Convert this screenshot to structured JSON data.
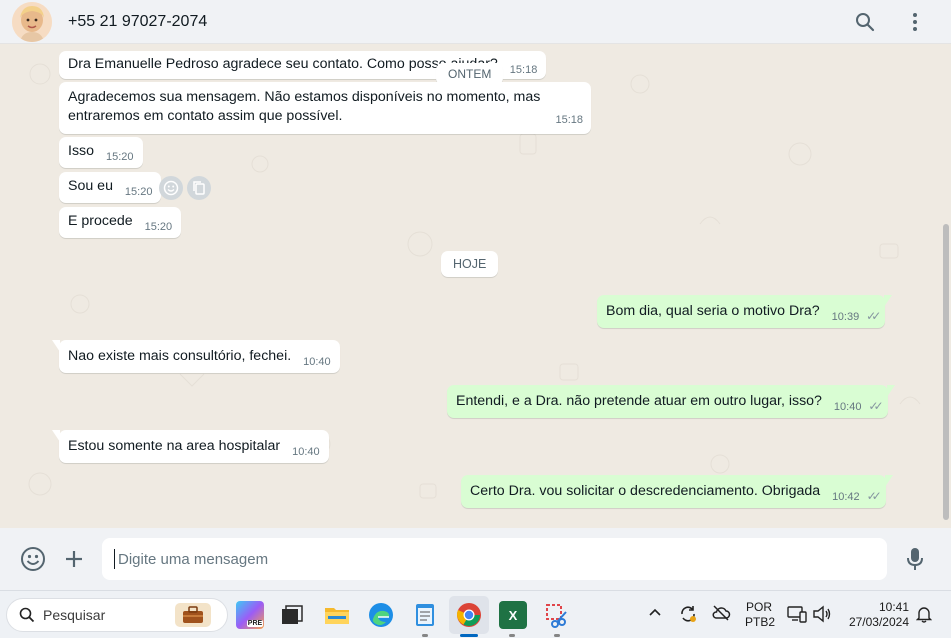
{
  "header": {
    "contact_name": "+55 21 97027-2074",
    "icons": [
      "avatar",
      "search-icon",
      "menu-icon"
    ]
  },
  "chat": {
    "date_chips": {
      "yesterday": "ONTEM",
      "today": "HOJE"
    },
    "messages": [
      {
        "dir": "in",
        "text": "Dra Emanuelle Pedroso agradece seu contato. Como posso ajudar?",
        "time": "15:18"
      },
      {
        "dir": "in",
        "text": "Agradecemos sua mensagem. Não estamos disponíveis no momento, mas entraremos em contato assim que possível.",
        "time": "15:18"
      },
      {
        "dir": "in",
        "text": "Isso",
        "time": "15:20"
      },
      {
        "dir": "in",
        "text": "Sou eu",
        "time": "15:20"
      },
      {
        "dir": "in",
        "text": "E procede",
        "time": "15:20"
      },
      {
        "dir": "out",
        "text": "Bom dia, qual seria o motivo Dra?",
        "time": "10:39",
        "status": "read"
      },
      {
        "dir": "in",
        "text": "Nao existe mais consultório,  fechei.",
        "time": "10:40"
      },
      {
        "dir": "out",
        "text": "Entendi, e a Dra. não pretende atuar em outro lugar, isso?",
        "time": "10:40",
        "status": "read"
      },
      {
        "dir": "in",
        "text": "Estou somente na area hospitalar",
        "time": "10:40"
      },
      {
        "dir": "out",
        "text": "Certo Dra. vou solicitar o descredenciamento. Obrigada",
        "time": "10:42",
        "status": "read"
      }
    ],
    "hover_actions": [
      "emoji-react-icon",
      "copy-icon"
    ]
  },
  "composer": {
    "placeholder": "Digite uma mensagem",
    "icons": [
      "emoji-icon",
      "attach-plus-icon",
      "microphone-icon"
    ]
  },
  "taskbar": {
    "search_label": "Pesquisar",
    "apps": [
      "briefcase",
      "copilot",
      "taskview",
      "file-explorer",
      "edge",
      "notepad",
      "chrome",
      "excel",
      "snipping-tool"
    ],
    "tray": {
      "language_line1": "POR",
      "language_line2": "PTB2",
      "time": "10:41",
      "date": "27/03/2024"
    }
  },
  "colors": {
    "chat_bg": "#efeae2",
    "incoming_bubble": "#ffffff",
    "outgoing_bubble": "#d9fdd3",
    "read_ticks": "#8696a0",
    "header_bg": "#f0f2f5"
  }
}
